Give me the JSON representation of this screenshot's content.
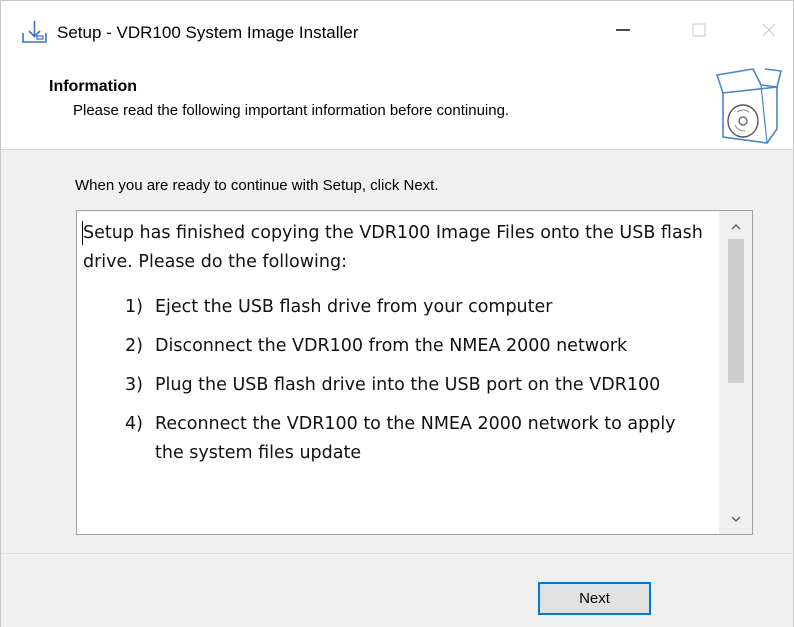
{
  "window": {
    "title": "Setup - VDR100 System Image Installer",
    "app_icon": "download-icon",
    "controls": {
      "minimize": "minimize-icon",
      "maximize": "maximize-icon",
      "close": "close-icon"
    }
  },
  "header": {
    "title": "Information",
    "subtitle": "Please read the following important information before continuing.",
    "icon": "box-disc-icon"
  },
  "main": {
    "continue_text": "When you are ready to continue with Setup, click Next.",
    "memo": {
      "intro": "Setup has finished copying the VDR100 Image Files onto the USB flash drive. Please do the following:",
      "steps": [
        {
          "num": "1)",
          "text": "Eject the USB flash drive from your computer"
        },
        {
          "num": "2)",
          "text": "Disconnect the VDR100 from the NMEA 2000 network"
        },
        {
          "num": "3)",
          "text": "Plug the USB flash drive into the USB port on the VDR100"
        },
        {
          "num": "4)",
          "text": "Reconnect the VDR100 to the NMEA 2000 network to apply the system files update"
        }
      ]
    },
    "scrollbar": {
      "up_icon": "chevron-up-icon",
      "down_icon": "chevron-down-icon"
    }
  },
  "footer": {
    "next_label": "Next"
  },
  "colors": {
    "accent": "#0078d7",
    "background": "#f0f0f0",
    "panel": "#ffffff"
  }
}
